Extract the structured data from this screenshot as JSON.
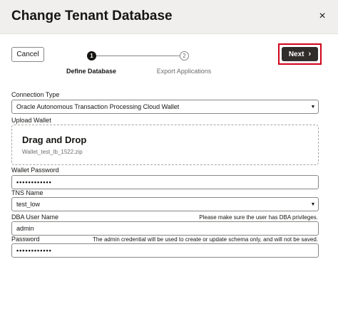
{
  "dialog": {
    "title": "Change Tenant Database",
    "close_glyph": "×"
  },
  "toolbar": {
    "cancel_label": "Cancel",
    "next_label": "Next",
    "next_icon": "chevron-right-icon",
    "next_glyph": "›",
    "highlight_color": "#d0021b"
  },
  "train": {
    "steps": [
      {
        "number": "1",
        "label": "Define Database",
        "active": true
      },
      {
        "number": "2",
        "label": "Export Applications",
        "active": false
      }
    ]
  },
  "form": {
    "connection_type": {
      "label": "Connection Type",
      "value": "Oracle Autonomous Transaction Processing Cloud Wallet"
    },
    "upload_wallet": {
      "label": "Upload Wallet",
      "drop_title": "Drag and Drop",
      "file_name": "Wallet_test_lb_1522.zip"
    },
    "wallet_password": {
      "label": "Wallet Password",
      "value": "••••••••••••"
    },
    "tns_name": {
      "label": "TNS Name",
      "value": "test_low"
    },
    "dba_user_name": {
      "label": "DBA User Name",
      "hint": "Please make sure the user has DBA privileges.",
      "value": "admin"
    },
    "password": {
      "label": "Password",
      "hint": "The admin credential will be used to create or update schema only, and will not be saved.",
      "value": "••••••••••••"
    }
  },
  "colors": {
    "header_bg": "#f1efed",
    "primary_button": "#312d2a"
  }
}
